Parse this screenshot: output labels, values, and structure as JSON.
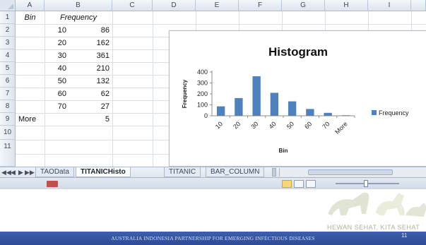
{
  "columns": [
    "A",
    "B",
    "C",
    "D",
    "E",
    "F",
    "G",
    "H",
    "I"
  ],
  "rows": [
    "1",
    "2",
    "3",
    "4",
    "5",
    "6",
    "7",
    "8",
    "9",
    "10",
    "11"
  ],
  "table": {
    "header": {
      "bin": "Bin",
      "frequency": "Frequency"
    },
    "data": [
      {
        "bin": "10",
        "frequency": "86"
      },
      {
        "bin": "20",
        "frequency": "162"
      },
      {
        "bin": "30",
        "frequency": "361"
      },
      {
        "bin": "40",
        "frequency": "210"
      },
      {
        "bin": "50",
        "frequency": "132"
      },
      {
        "bin": "60",
        "frequency": "62"
      },
      {
        "bin": "70",
        "frequency": "27"
      },
      {
        "bin": "More",
        "frequency": "5"
      }
    ]
  },
  "chart_data": {
    "type": "bar",
    "title": "Histogram",
    "xlabel": "Bin",
    "ylabel": "Frequency",
    "categories": [
      "10",
      "20",
      "30",
      "40",
      "50",
      "60",
      "70",
      "More"
    ],
    "series": [
      {
        "name": "Frequency",
        "values": [
          86,
          162,
          361,
          210,
          132,
          62,
          27,
          5
        ],
        "color": "#4f81bd"
      }
    ],
    "ylim": [
      0,
      400
    ],
    "yticks": [
      "0",
      "100",
      "200",
      "300",
      "400"
    ],
    "legend": "right",
    "grid": false
  },
  "tabs": {
    "nav": [
      "◀◀",
      "◀",
      "▶",
      "▶▶"
    ],
    "items": [
      {
        "label": "TAOData",
        "active": false
      },
      {
        "label": "TITANICHisto",
        "active": true
      },
      {
        "label": "TITANIC",
        "active": false
      },
      {
        "label": "BAR_COLUMN",
        "active": false
      }
    ]
  },
  "slide": {
    "watermark": "HEWAN SEHAT, KITA SEHAT",
    "footer": "AUSTRALIA INDONESIA PARTNERSHIP FOR EMERGING INFECTIOUS DISEASES",
    "page_number": "11"
  },
  "colors": {
    "bar": "#4f81bd",
    "footer_band": "#33509e",
    "grid": "#dadfe6",
    "header": "#dde4ee"
  }
}
